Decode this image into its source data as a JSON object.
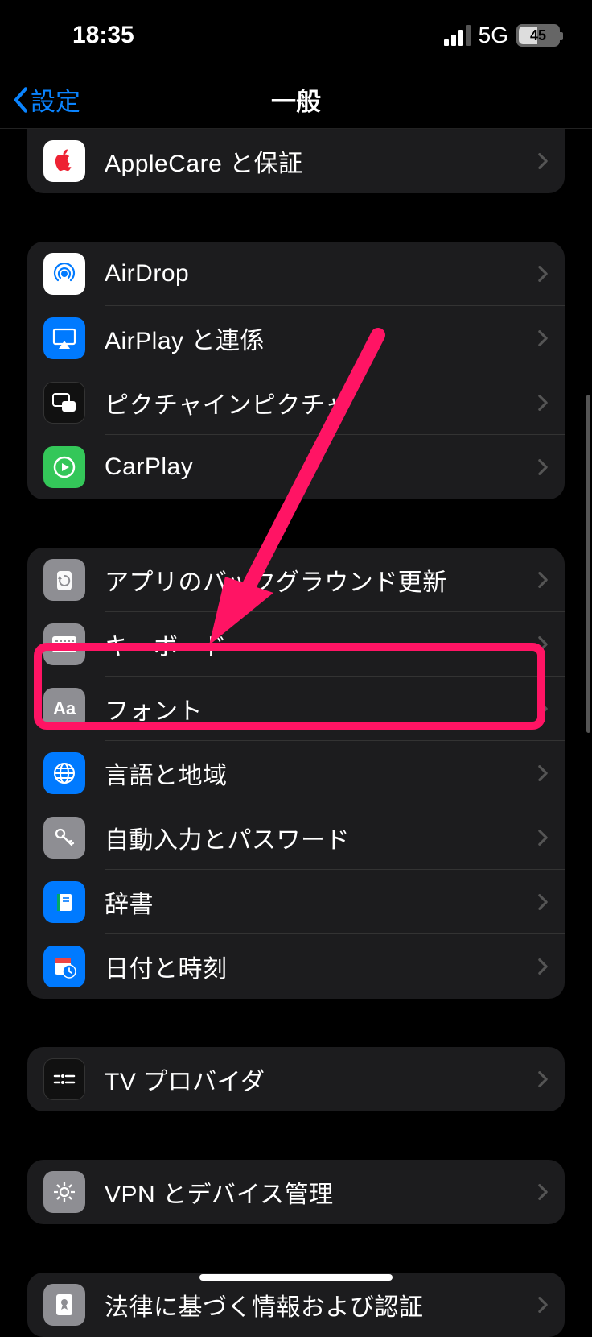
{
  "status": {
    "time": "18:35",
    "network": "5G",
    "battery": "45"
  },
  "nav": {
    "back": "設定",
    "title": "一般"
  },
  "groups": [
    {
      "rows": [
        {
          "key": "applecare",
          "label": "AppleCare と保証"
        }
      ]
    },
    {
      "rows": [
        {
          "key": "airdrop",
          "label": "AirDrop"
        },
        {
          "key": "airplay",
          "label": "AirPlay と連係"
        },
        {
          "key": "pip",
          "label": "ピクチャインピクチャ"
        },
        {
          "key": "carplay",
          "label": "CarPlay"
        }
      ]
    },
    {
      "rows": [
        {
          "key": "bgrefresh",
          "label": "アプリのバックグラウンド更新"
        },
        {
          "key": "keyboard",
          "label": "キーボード"
        },
        {
          "key": "fonts",
          "label": "フォント"
        },
        {
          "key": "lang",
          "label": "言語と地域"
        },
        {
          "key": "autofill",
          "label": "自動入力とパスワード"
        },
        {
          "key": "dict",
          "label": "辞書"
        },
        {
          "key": "datetime",
          "label": "日付と時刻"
        }
      ]
    },
    {
      "rows": [
        {
          "key": "tvprov",
          "label": "TV プロバイダ"
        }
      ]
    },
    {
      "rows": [
        {
          "key": "vpn",
          "label": "VPN とデバイス管理"
        }
      ]
    },
    {
      "rows": [
        {
          "key": "legal",
          "label": "法律に基づく情報および認証"
        }
      ]
    }
  ]
}
